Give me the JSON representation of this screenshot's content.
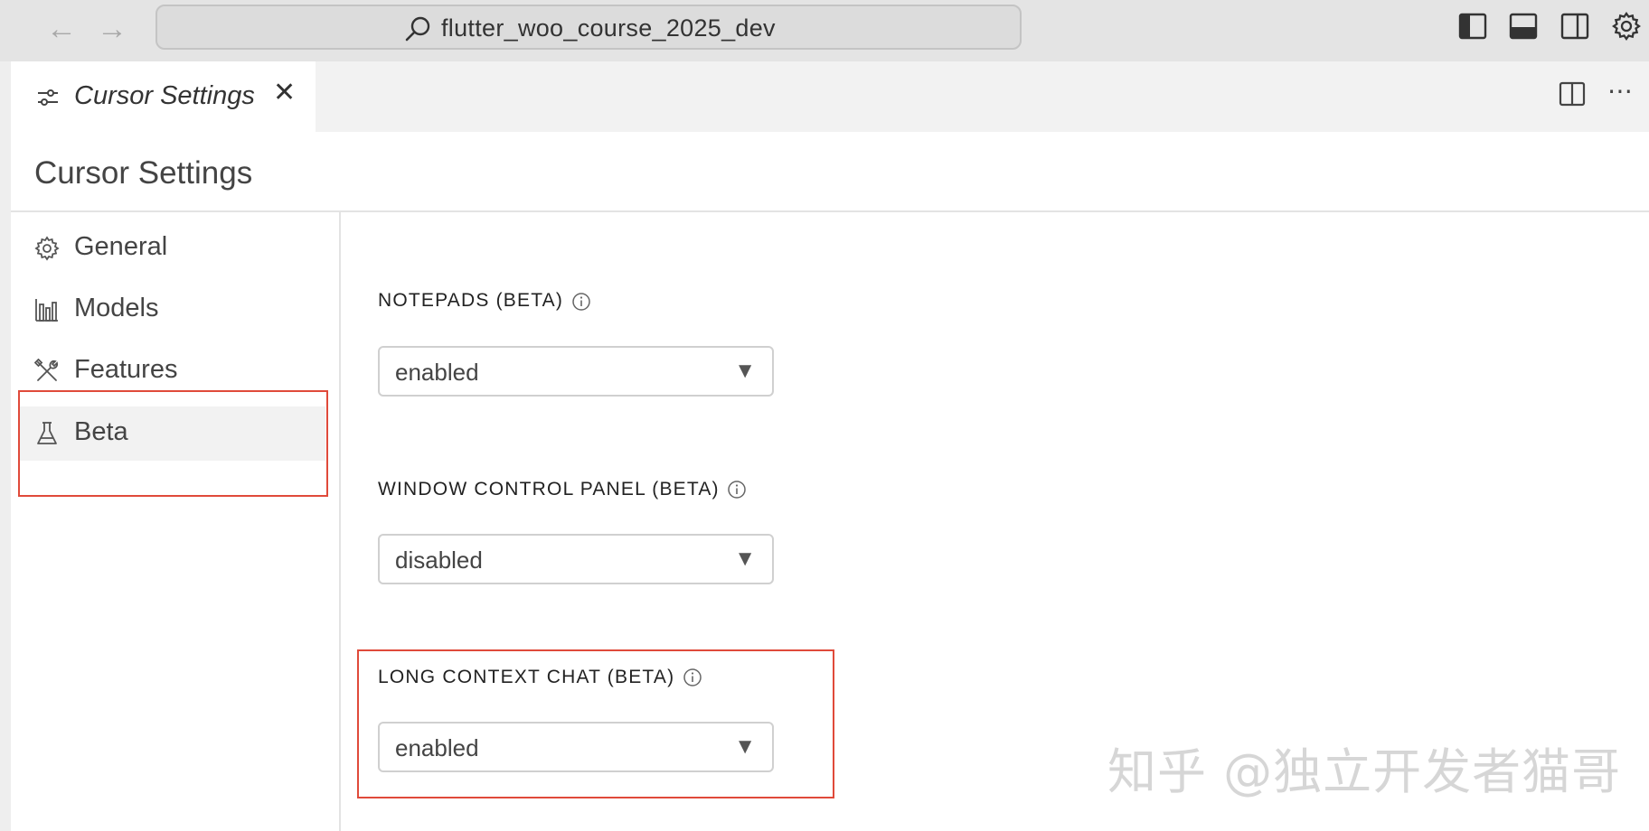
{
  "address_bar": {
    "text": "flutter_woo_course_2025_dev"
  },
  "tab": {
    "label": "Cursor Settings"
  },
  "page": {
    "title": "Cursor Settings"
  },
  "sidebar": {
    "items": [
      {
        "label": "General",
        "icon": "gear-icon"
      },
      {
        "label": "Models",
        "icon": "bar-chart-icon"
      },
      {
        "label": "Features",
        "icon": "tools-icon"
      },
      {
        "label": "Beta",
        "icon": "flask-icon",
        "active": true
      }
    ]
  },
  "settings": [
    {
      "label": "NOTEPADS (BETA)",
      "value": "enabled"
    },
    {
      "label": "WINDOW CONTROL PANEL (BETA)",
      "value": "disabled"
    },
    {
      "label": "LONG CONTEXT CHAT (BETA)",
      "value": "enabled"
    }
  ],
  "watermark": {
    "text": "知乎 @独立开发者猫哥"
  },
  "colors": {
    "highlight": "#e04a3a",
    "titlebar": "#e4e4e4",
    "active_item": "#f2f2f2"
  }
}
